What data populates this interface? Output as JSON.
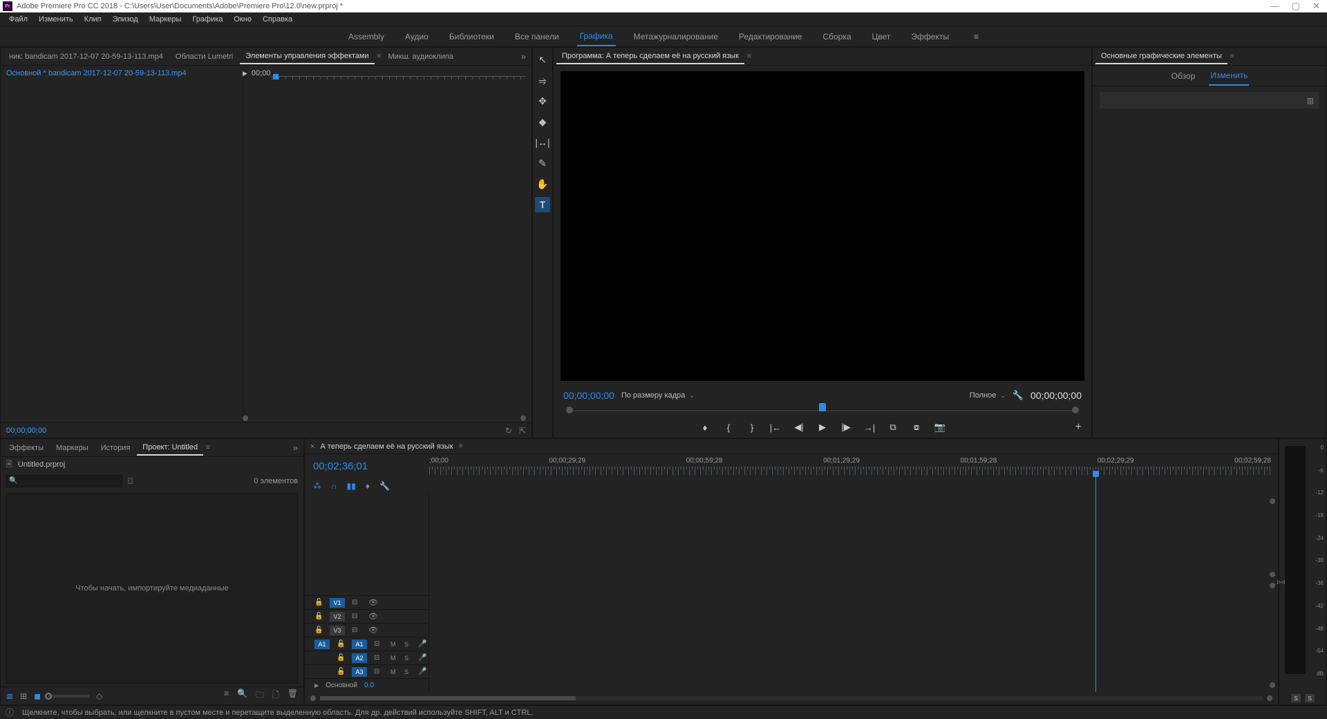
{
  "titlebar": {
    "text": "Adobe Premiere Pro CC 2018 - C:\\Users\\User\\Documents\\Adobe\\Premiere Pro\\12.0\\new.prproj *",
    "app_icon": "Pr"
  },
  "menubar": [
    "Файл",
    "Изменить",
    "Клип",
    "Эпизод",
    "Маркеры",
    "Графика",
    "Окно",
    "Справка"
  ],
  "workspaces": [
    "Assembly",
    "Аудио",
    "Библиотеки",
    "Все панели",
    "Графика",
    "Метажурналирование",
    "Редактирование",
    "Сборка",
    "Цвет",
    "Эффекты"
  ],
  "workspace_active": "Графика",
  "effect_controls": {
    "tabs": [
      "ник: bandicam 2017-12-07 20-59-13-113.mp4",
      "Области Lumetri",
      "Элементы управления эффектами",
      "Микш. аудиоклипа"
    ],
    "active_tab": "Элементы управления эффектами",
    "clip_line": "Основной * bandicam 2017-12-07 20-59-13-113.mp4",
    "ruler_tc": "00;00",
    "footer_tc": "00;00;00;00"
  },
  "program": {
    "title": "Программа: А теперь сделаем её на русский язык",
    "tc_left": "00;00;00;00",
    "fit": "По размеру кадра",
    "quality": "Полное",
    "tc_right": "00;00;00;00",
    "scrub_mark_pct": 50
  },
  "essential_graphics": {
    "title": "Основные графические элементы",
    "tabs": [
      "Обзор",
      "Изменить"
    ],
    "active": "Изменить"
  },
  "project": {
    "tabs": [
      "Эффекты",
      "Маркеры",
      "История",
      "Проект: Untitled"
    ],
    "active": "Проект: Untitled",
    "file": "Untitled.prproj",
    "search_placeholder": "",
    "count": "0 элементов",
    "empty_msg": "Чтобы начать, импортируйте медиаданные"
  },
  "timeline": {
    "seq_name": "А теперь сделаем её на русский язык",
    "tc": "00;02;36;01",
    "ruler": [
      ";00;00",
      "00;00;29;29",
      "00;00;59;28",
      "00;01;29;29",
      "00;01;59;28",
      "00;02;29;29",
      "00;02;59;28"
    ],
    "playhead_pct": 78.5,
    "video_tracks": [
      {
        "label": "V3",
        "on": false
      },
      {
        "label": "V2",
        "on": false
      },
      {
        "label": "V1",
        "on": true
      }
    ],
    "audio_tracks": [
      {
        "src": "A1",
        "label": "A1",
        "on": true
      },
      {
        "src": "",
        "label": "A2",
        "on": true
      },
      {
        "src": "",
        "label": "A3",
        "on": true
      }
    ],
    "master": {
      "label": "Основной",
      "value": "0.0"
    }
  },
  "meter": {
    "labels": [
      "0",
      "-6",
      "-12",
      "-18",
      "-24",
      "-30",
      "-36",
      "-42",
      "-48",
      "-54",
      "dB"
    ],
    "solo": "S"
  },
  "statusbar": "Щелкните, чтобы выбрать, или щелкните в пустом месте и перетащите выделенную область. Для др. действий используйте SHIFT, ALT и CTRL."
}
